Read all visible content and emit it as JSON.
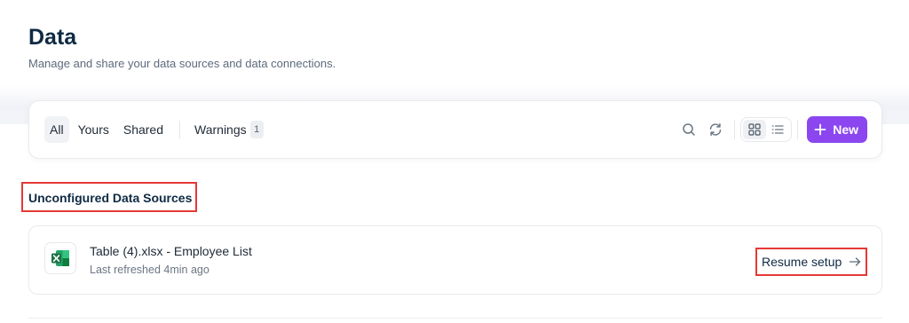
{
  "header": {
    "title": "Data",
    "subtitle": "Manage and share your data sources and data connections."
  },
  "toolbar": {
    "filters": [
      {
        "label": "All",
        "active": true
      },
      {
        "label": "Yours",
        "active": false
      },
      {
        "label": "Shared",
        "active": false
      }
    ],
    "warnings": {
      "label": "Warnings",
      "count": "1"
    },
    "icons": {
      "search": "search-icon",
      "refresh": "refresh-icon",
      "grid_view": "grid-view-icon",
      "list_view": "list-view-icon",
      "plus": "plus-icon"
    },
    "view_mode": "grid",
    "new_label": "New"
  },
  "sections": {
    "unconfigured": {
      "title": "Unconfigured Data Sources",
      "items": [
        {
          "name": "Table (4).xlsx - Employee List",
          "meta": "Last refreshed 4min ago",
          "icon": "excel-file-icon",
          "action_label": "Resume setup"
        }
      ]
    }
  },
  "colors": {
    "accent": "#8b46f0",
    "title": "#0f2a44",
    "highlight": "#e53935",
    "excel_green": "#1e7145"
  }
}
